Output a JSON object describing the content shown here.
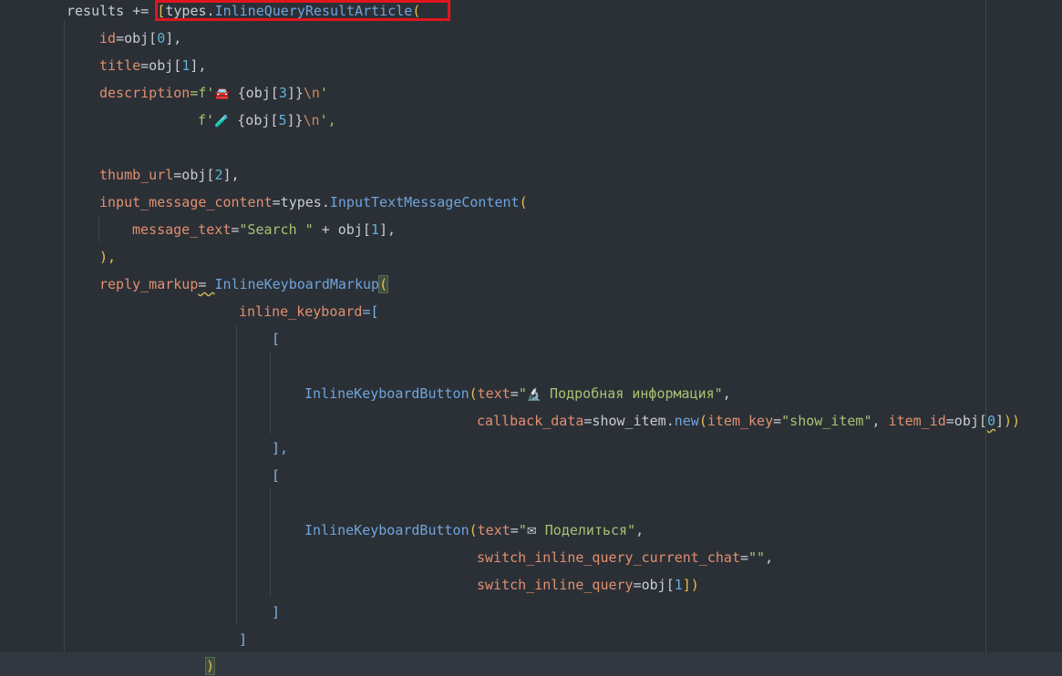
{
  "editor": {
    "language": "python",
    "highlight_color": "#e0161e",
    "lines": {
      "l1": {
        "a": "results",
        "b": " += ",
        "c": "[",
        "d": "types.",
        "e": "InlineQueryResultArticle",
        "f": "("
      },
      "l2": {
        "a": "id",
        "b": "=obj[",
        "c": "0",
        "d": "],"
      },
      "l3": {
        "a": "title",
        "b": "=obj[",
        "c": "1",
        "d": "],"
      },
      "l4": {
        "a": "description",
        "b": "=f'",
        "icon": "🚘",
        "c": " {obj[",
        "d": "3",
        "e": "]}",
        "f": "\\n",
        "g": "'"
      },
      "l5": {
        "a": "f'",
        "icon": "🧪",
        "b": " {obj[",
        "c": "5",
        "d": "]}",
        "e": "\\n",
        "f": "',",
        "g": ""
      },
      "l7": {
        "a": "thumb_url",
        "b": "=obj[",
        "c": "2",
        "d": "],"
      },
      "l8": {
        "a": "input_message_content",
        "b": "=types.",
        "c": "InputTextMessageContent",
        "d": "("
      },
      "l9": {
        "a": "message_text",
        "b": "=",
        "c": "\"Search \"",
        "d": " + obj[",
        "e": "1",
        "f": "],"
      },
      "l10": {
        "a": "),"
      },
      "l11": {
        "a": "reply_markup",
        "b": "= ",
        "c": "InlineKeyboardMarkup",
        "d": "("
      },
      "l12": {
        "a": "inline_keyboard",
        "b": "=["
      },
      "l13": {
        "a": "["
      },
      "l15": {
        "a": "InlineKeyboardButton",
        "b": "(",
        "c": "text",
        "d": "=",
        "e": "\"",
        "icon": "🔬",
        "f": " Подробная информация\"",
        "g": ","
      },
      "l16": {
        "a": "callback_data",
        "b": "=show_item.",
        "c": "new",
        "d": "(",
        "e": "item_key",
        "f": "=",
        "g": "\"show_item\"",
        "h": ", ",
        "i": "item_id",
        "j": "=obj[",
        "k": "0",
        "l": "]",
        "m": "))"
      },
      "l17": {
        "a": "],"
      },
      "l18": {
        "a": "["
      },
      "l20": {
        "a": "InlineKeyboardButton",
        "b": "(",
        "c": "text",
        "d": "=",
        "e": "\"",
        "icon": "✉",
        "f": " Поделиться\"",
        "g": ","
      },
      "l21": {
        "a": "switch_inline_query_current_chat",
        "b": "=",
        "c": "\"\"",
        "d": ","
      },
      "l22": {
        "a": "switch_inline_query",
        "b": "=obj[",
        "c": "1",
        "d": "])"
      },
      "l23": {
        "a": "]"
      },
      "l24": {
        "a": "]"
      },
      "l25": {
        "a": ")"
      }
    }
  }
}
